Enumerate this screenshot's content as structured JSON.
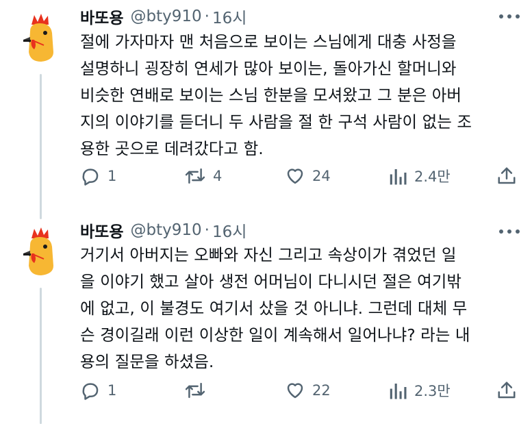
{
  "tweets": [
    {
      "name": "바또용",
      "handle": "@bty910",
      "separator": "·",
      "time": "16시",
      "lines": [
        "절에 가자마자 맨 처음으로 보이는 스님에게 대충 사정을",
        "설명하니 굉장히 연세가 많아 보이는, 돌아가신 할머니와",
        "비슷한 연배로 보이는 스님 한분을 모셔왔고 그 분은 아버",
        "지의 이야기를 듣더니 두 사람을 절 한 구석 사람이 없는 조",
        "용한 곳으로 데려갔다고 함."
      ],
      "replies": "1",
      "retweets": "4",
      "likes": "24",
      "views": "2.4만"
    },
    {
      "name": "바또용",
      "handle": "@bty910",
      "separator": "·",
      "time": "16시",
      "lines": [
        "거기서 아버지는 오빠와 자신 그리고 속상이가 겪었던 일",
        "을 이야기 했고 살아 생전 어머님이 다니시던 절은 여기밖",
        "에 없고, 이 불경도 여기서 샀을 것 아니냐. 그런데 대체 무",
        "슨 경이길래 이런 이상한 일이 계속해서 일어나냐? 라는 내",
        "용의 질문을 하셨음."
      ],
      "replies": "1",
      "retweets": "",
      "likes": "22",
      "views": "2.3만"
    }
  ],
  "icons": {
    "reply": "reply-icon",
    "retweet": "retweet-icon",
    "like": "heart-icon",
    "views": "views-icon",
    "share": "share-icon",
    "more": "more-icon",
    "avatar": "rooster-avatar"
  },
  "colors": {
    "text": "#0f1419",
    "secondary": "#536471",
    "thread_line": "#cfd9de",
    "rooster_comb": "#e8321e",
    "rooster_body": "#f7b733"
  }
}
